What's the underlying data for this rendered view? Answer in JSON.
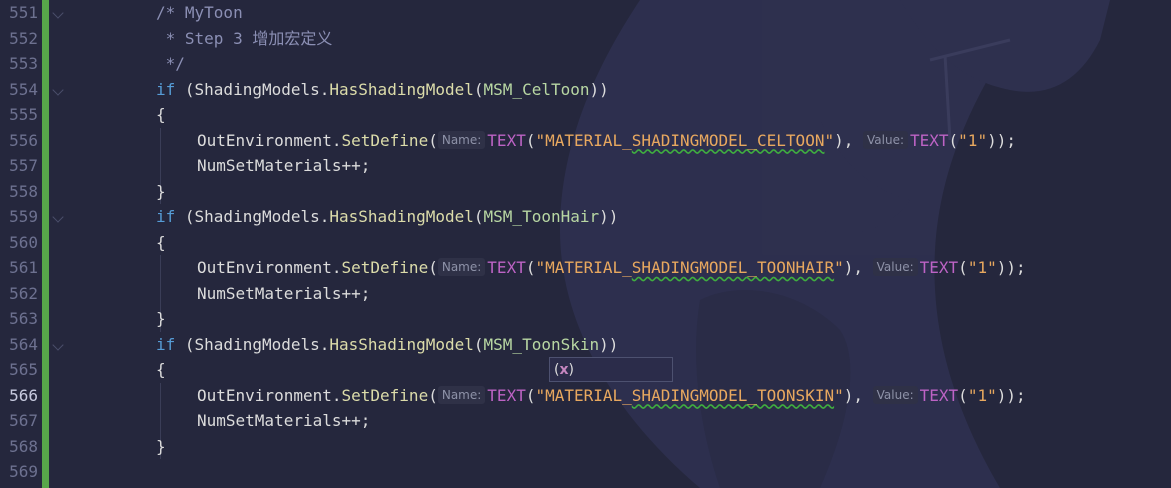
{
  "editor": {
    "colors": {
      "background": "#25273d",
      "change_bar": "#57a64a",
      "keyword": "#569cd6",
      "comment": "#8b8fb4",
      "function": "#dcdcaa",
      "macro": "#bd63c5",
      "string": "#e8a85f",
      "enum": "#b8d7a3"
    },
    "current_line": "566",
    "lines": [
      {
        "n": "551",
        "comment": "/* MyToon"
      },
      {
        "n": "552",
        "comment": " * Step 3 增加宏定义"
      },
      {
        "n": "553",
        "comment": " */"
      },
      {
        "n": "554",
        "kw": "if",
        "pre": " (ShadingModels.",
        "fn": "HasShadingModel",
        "open": "(",
        "enum": "MSM_CelToon",
        "close": "))"
      },
      {
        "n": "555",
        "brace": "{"
      },
      {
        "n": "556",
        "obj": "OutEnvironment.",
        "fn": "SetDefine",
        "open": "(",
        "hint1": "Name:",
        "mac1": "TEXT",
        "str1": "\"MATERIAL_SHADINGMODEL_CELTOON\"",
        "mid": "), ",
        "hint2": "Value:",
        "mac2": "TEXT",
        "str2": "\"1\"",
        "end": "));"
      },
      {
        "n": "557",
        "stmt": "NumSetMaterials++;"
      },
      {
        "n": "558",
        "brace": "}"
      },
      {
        "n": "559",
        "kw": "if",
        "pre": " (ShadingModels.",
        "fn": "HasShadingModel",
        "open": "(",
        "enum": "MSM_ToonHair",
        "close": "))"
      },
      {
        "n": "560",
        "brace": "{"
      },
      {
        "n": "561",
        "obj": "OutEnvironment.",
        "fn": "SetDefine",
        "open": "(",
        "hint1": "Name:",
        "mac1": "TEXT",
        "str1": "\"MATERIAL_SHADINGMODEL_TOONHAIR\"",
        "mid": "), ",
        "hint2": "Value:",
        "mac2": "TEXT",
        "str2": "\"1\"",
        "end": "));"
      },
      {
        "n": "562",
        "stmt": "NumSetMaterials++;"
      },
      {
        "n": "563",
        "brace": "}"
      },
      {
        "n": "564",
        "kw": "if",
        "pre": " (ShadingModels.",
        "fn": "HasShadingModel",
        "open": "(",
        "enum": "MSM_ToonSkin",
        "close": "))"
      },
      {
        "n": "565",
        "brace": "{"
      },
      {
        "n": "566",
        "obj": "OutEnvironment.",
        "fn": "SetDefine",
        "open": "(",
        "hint1": "Name:",
        "mac1": "TEXT",
        "str1": "\"MATERIAL_SHADINGMODEL_TOONSKIN\"",
        "mid": "), ",
        "hint2": "Value:",
        "mac2": "TEXT",
        "str2": "\"1\"",
        "end": "));"
      },
      {
        "n": "567",
        "stmt": "NumSetMaterials++;"
      },
      {
        "n": "568",
        "brace": "}"
      },
      {
        "n": "569"
      }
    ],
    "tooltip": {
      "text_open": "(",
      "text_x": "x",
      "text_close": ")"
    }
  }
}
